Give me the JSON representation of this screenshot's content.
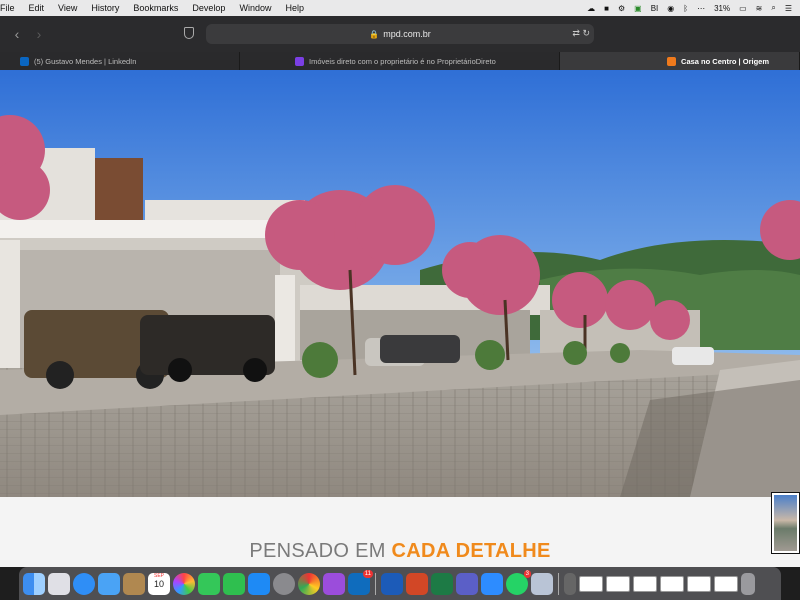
{
  "menubar": {
    "items": [
      "File",
      "Edit",
      "View",
      "History",
      "Bookmarks",
      "Develop",
      "Window",
      "Help"
    ],
    "battery": "31%"
  },
  "browser": {
    "url": "mpd.com.br",
    "tabs": [
      {
        "label": "(5) Gustavo Mendes | LinkedIn",
        "icon": "linkedin-icon",
        "color": "#0a66c2"
      },
      {
        "label": "Imóveis direto com o proprietário é no ProprietárioDireto",
        "icon": "proprietariodireto-icon",
        "color": "#7b3fe4"
      },
      {
        "label": "Casa no Centro | Origem",
        "icon": "origem-icon",
        "color": "#f07a1c"
      }
    ]
  },
  "page": {
    "tagline_part1": "PENSADO EM ",
    "tagline_part2": "CADA DETALHE",
    "accent_color": "#f08a1c"
  },
  "dock": {
    "calendar_month": "SEP",
    "calendar_day": "10",
    "outlook_badge": "11",
    "whatsapp_badge": "3"
  }
}
